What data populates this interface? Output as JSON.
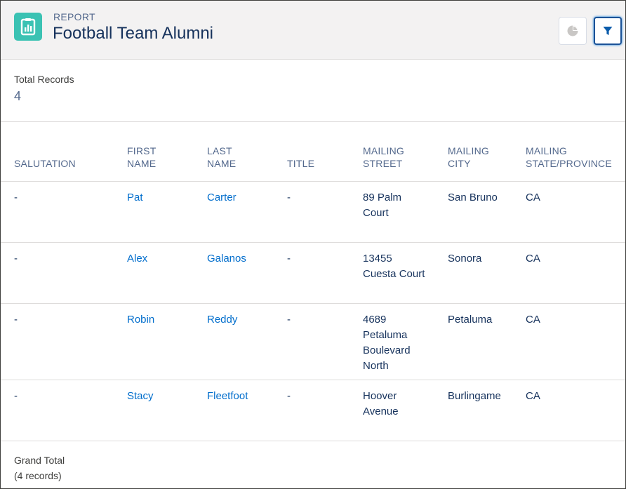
{
  "header": {
    "eyebrow": "REPORT",
    "title": "Football Team Alumni",
    "icon": "report-icon",
    "buttons": [
      {
        "name": "chart-button",
        "icon": "pie-chart-icon",
        "state": "disabled"
      },
      {
        "name": "filter-button",
        "icon": "filter-icon",
        "state": "active"
      }
    ]
  },
  "summary": {
    "label": "Total Records",
    "value": "4"
  },
  "table": {
    "headers": [
      {
        "line1": "",
        "line2": "SALUTATION"
      },
      {
        "line1": "FIRST",
        "line2": "NAME"
      },
      {
        "line1": "LAST",
        "line2": "NAME"
      },
      {
        "line1": "",
        "line2": "TITLE"
      },
      {
        "line1": "MAILING",
        "line2": "STREET"
      },
      {
        "line1": "MAILING",
        "line2": "CITY"
      },
      {
        "line1": "MAILING",
        "line2": "STATE/PROVINCE"
      }
    ],
    "rows": [
      {
        "salutation": "-",
        "first_name": "Pat",
        "last_name": "Carter",
        "title": "-",
        "street": [
          "89 Palm",
          "Court"
        ],
        "city": "San Bruno",
        "state": "CA"
      },
      {
        "salutation": "-",
        "first_name": "Alex",
        "last_name": "Galanos",
        "title": "-",
        "street": [
          "13455",
          "Cuesta Court"
        ],
        "city": "Sonora",
        "state": "CA"
      },
      {
        "salutation": "-",
        "first_name": "Robin",
        "last_name": "Reddy",
        "title": "-",
        "street": [
          "4689",
          "Petaluma",
          "Boulevard",
          "North"
        ],
        "city": "Petaluma",
        "state": "CA"
      },
      {
        "salutation": "-",
        "first_name": "Stacy",
        "last_name": "Fleetfoot",
        "title": "-",
        "street": [
          "Hoover",
          "Avenue"
        ],
        "city": "Burlingame",
        "state": "CA"
      }
    ]
  },
  "footer": {
    "label": "Grand Total",
    "count": "(4 records)"
  },
  "colors": {
    "icon_bg": "#3bc2b3",
    "link": "#006dcc",
    "header_bg": "#f3f2f2",
    "active_button_border": "#1b5297"
  }
}
